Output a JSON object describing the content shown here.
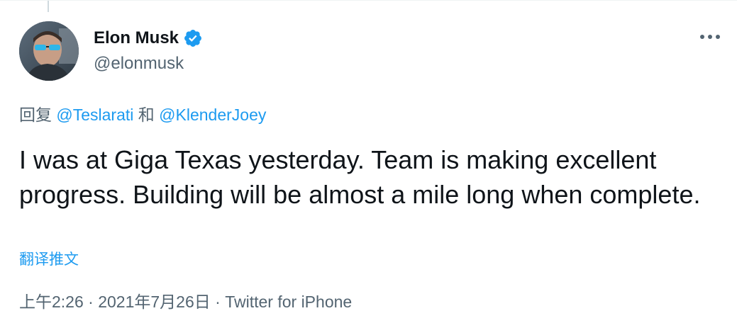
{
  "author": {
    "display_name": "Elon Musk",
    "handle": "@elonmusk",
    "verified": true
  },
  "icons": {
    "verified": "verified-badge-icon",
    "more": "more-horizontal-icon"
  },
  "reply": {
    "prefix": "回复",
    "mention_1": "@Teslarati",
    "conjunction": "和",
    "mention_2": "@KlenderJoey"
  },
  "tweet": {
    "text": "I was at Giga Texas yesterday. Team is making excellent progress. Building will be almost a mile long when complete.",
    "translate_label": "翻译推文"
  },
  "meta": {
    "time": "上午2:26",
    "separator": "·",
    "date": "2021年7月26日",
    "source": "Twitter for iPhone"
  },
  "colors": {
    "accent": "#1d9bf0",
    "text_primary": "#0f1419",
    "text_secondary": "#536471"
  }
}
